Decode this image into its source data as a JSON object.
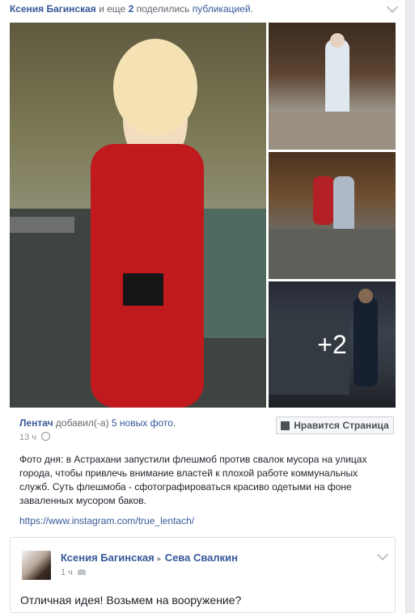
{
  "share": {
    "name": "Ксения Багинская",
    "middle": " и еще ",
    "count": "2",
    "verb": " поделились ",
    "link": "публикацией",
    "dot": "."
  },
  "photos": {
    "more_label": "+2"
  },
  "post": {
    "page_name": "Лентач",
    "added_text": " добавил(-а) ",
    "photos_link": "5 новых фото",
    "dot": ".",
    "time": "13 ч",
    "like_button_label": "Нравится Страница",
    "text": "Фото дня: в Астрахани запустили флешмоб против свалок мусора на улицах города, чтобы привлечь внимание властей к плохой работе коммунальных служб. Суть флешмоба - сфотографироваться красиво одетыми на фоне заваленных мусором баков.",
    "url": "https://www.instagram.com/true_lentach/"
  },
  "comment": {
    "author": "Ксения Багинская",
    "arrow": "▸",
    "target": "Сева Свалкин",
    "time": "1 ч",
    "text": "Отличная идея! Возьмем на вооружение?"
  },
  "colors": {
    "link": "#365899",
    "muted": "#90949c",
    "background": "#e9ebee"
  }
}
